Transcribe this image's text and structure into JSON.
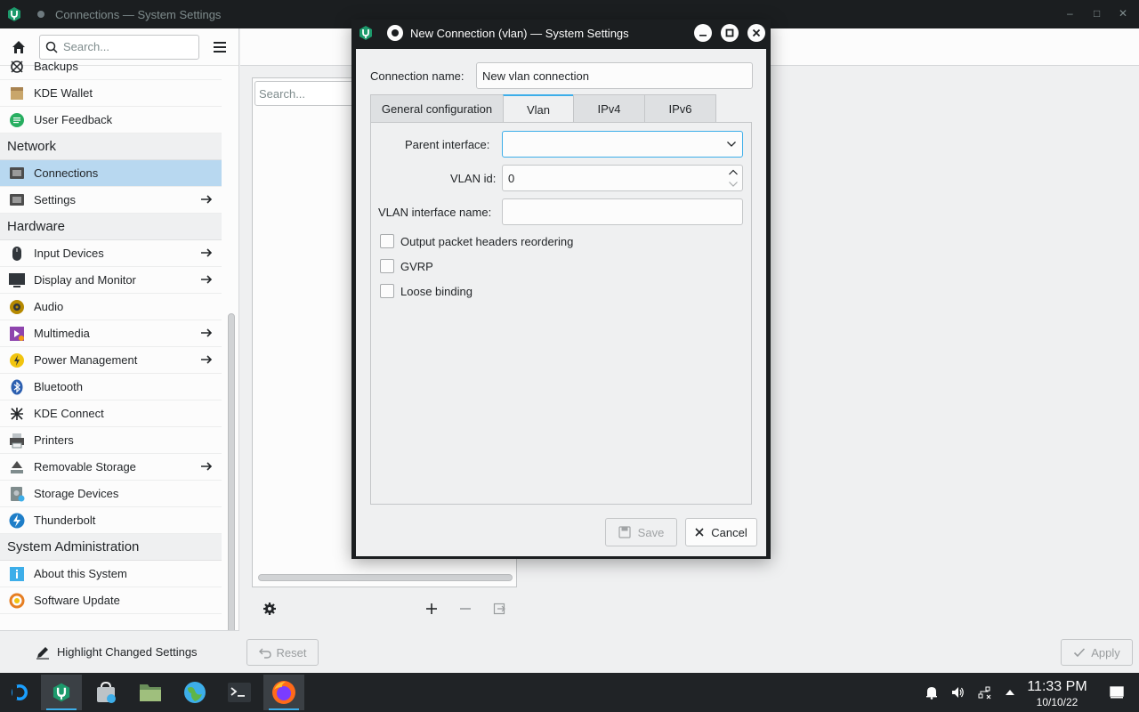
{
  "main_window": {
    "title": "Connections — System Settings"
  },
  "sidebar": {
    "search_placeholder": "Search...",
    "items": [
      {
        "type": "item",
        "label": "Backups",
        "icon": "backups-icon",
        "arrow": false
      },
      {
        "type": "item",
        "label": "KDE Wallet",
        "icon": "wallet-icon",
        "arrow": false
      },
      {
        "type": "item",
        "label": "User Feedback",
        "icon": "feedback-icon",
        "arrow": false
      },
      {
        "type": "header",
        "label": "Network"
      },
      {
        "type": "item",
        "label": "Connections",
        "icon": "connections-icon",
        "arrow": false,
        "selected": true
      },
      {
        "type": "item",
        "label": "Settings",
        "icon": "network-settings-icon",
        "arrow": true
      },
      {
        "type": "header",
        "label": "Hardware"
      },
      {
        "type": "item",
        "label": "Input Devices",
        "icon": "mouse-icon",
        "arrow": true
      },
      {
        "type": "item",
        "label": "Display and Monitor",
        "icon": "monitor-icon",
        "arrow": true
      },
      {
        "type": "item",
        "label": "Audio",
        "icon": "audio-icon",
        "arrow": false
      },
      {
        "type": "item",
        "label": "Multimedia",
        "icon": "multimedia-icon",
        "arrow": true
      },
      {
        "type": "item",
        "label": "Power Management",
        "icon": "power-icon",
        "arrow": true
      },
      {
        "type": "item",
        "label": "Bluetooth",
        "icon": "bluetooth-icon",
        "arrow": false
      },
      {
        "type": "item",
        "label": "KDE Connect",
        "icon": "kde-connect-icon",
        "arrow": false
      },
      {
        "type": "item",
        "label": "Printers",
        "icon": "printer-icon",
        "arrow": false
      },
      {
        "type": "item",
        "label": "Removable Storage",
        "icon": "removable-storage-icon",
        "arrow": true
      },
      {
        "type": "item",
        "label": "Storage Devices",
        "icon": "storage-devices-icon",
        "arrow": false
      },
      {
        "type": "item",
        "label": "Thunderbolt",
        "icon": "thunderbolt-icon",
        "arrow": false
      },
      {
        "type": "header",
        "label": "System Administration"
      },
      {
        "type": "item",
        "label": "About this System",
        "icon": "info-icon",
        "arrow": false
      },
      {
        "type": "item",
        "label": "Software Update",
        "icon": "update-icon",
        "arrow": false
      }
    ],
    "highlight_label": "Highlight Changed Settings"
  },
  "content": {
    "search_placeholder": "Search...",
    "reset_label": "Reset",
    "apply_label": "Apply"
  },
  "dialog": {
    "title": "New Connection (vlan) — System Settings",
    "connection_name_label": "Connection name:",
    "connection_name_value": "New vlan connection",
    "tabs": [
      "General configuration",
      "Vlan",
      "IPv4",
      "IPv6"
    ],
    "active_tab": "Vlan",
    "parent_interface_label": "Parent interface:",
    "parent_interface_value": "",
    "vlan_id_label": "VLAN id:",
    "vlan_id_value": "0",
    "vlan_interface_name_label": "VLAN interface name:",
    "vlan_interface_name_value": "",
    "checkboxes": [
      {
        "label": "Output packet headers reordering",
        "checked": false
      },
      {
        "label": "GVRP",
        "checked": false
      },
      {
        "label": "Loose binding",
        "checked": false
      }
    ],
    "save_label": "Save",
    "cancel_label": "Cancel"
  },
  "taskbar": {
    "time": "11:33 PM",
    "date": "10/10/22"
  },
  "colors": {
    "accent": "#3daee9",
    "selection": "#b8d8f0",
    "titlebar": "#1b1e20",
    "taskbar": "#202326"
  }
}
